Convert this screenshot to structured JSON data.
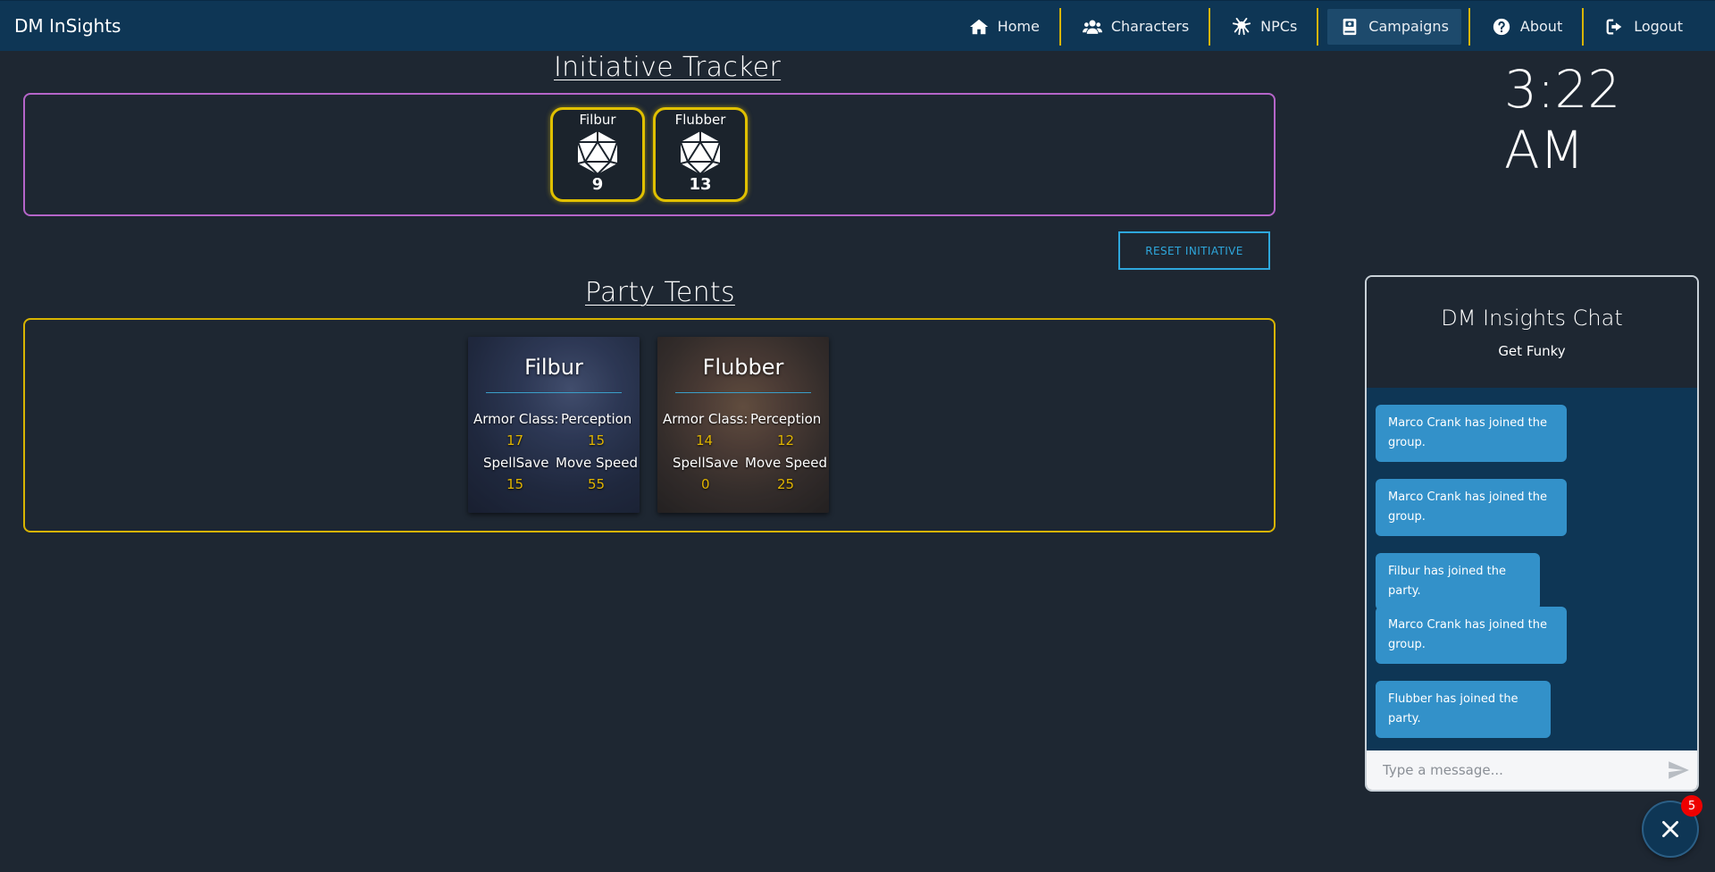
{
  "brand": "DM InSights",
  "nav": {
    "items": [
      {
        "label": "Home",
        "icon": "home-icon"
      },
      {
        "label": "Characters",
        "icon": "users-icon"
      },
      {
        "label": "NPCs",
        "icon": "npc-icon"
      },
      {
        "label": "Campaigns",
        "icon": "book-icon",
        "active": true
      },
      {
        "label": "About",
        "icon": "question-icon"
      },
      {
        "label": "Logout",
        "icon": "logout-icon"
      }
    ]
  },
  "initiative": {
    "title": "Initiative Tracker",
    "entries": [
      {
        "name": "Filbur",
        "value": "9"
      },
      {
        "name": "Flubber",
        "value": "13"
      }
    ],
    "reset_label": "RESET INITIATIVE"
  },
  "tents": {
    "title": "Party Tents",
    "cards": [
      {
        "name": "Filbur",
        "labels": {
          "ac": "Armor Class:",
          "perception": "Perception",
          "spellsave": "SpellSave",
          "speed": "Move Speed"
        },
        "values": {
          "ac": "17",
          "perception": "15",
          "spellsave": "15",
          "speed": "55"
        }
      },
      {
        "name": "Flubber",
        "labels": {
          "ac": "Armor Class:",
          "perception": "Perception",
          "spellsave": "SpellSave",
          "speed": "Move Speed"
        },
        "values": {
          "ac": "14",
          "perception": "12",
          "spellsave": "0",
          "speed": "25"
        }
      }
    ]
  },
  "clock": "3:22 AM",
  "chat": {
    "title": "DM Insights Chat",
    "subtitle": "Get Funky",
    "messages": [
      "Marco Crank has joined the group.",
      "Marco Crank has joined the group.",
      "Filbur has joined the party.",
      "Marco Crank has joined the group.",
      "Flubber has joined the party."
    ],
    "input_placeholder": "Type a message...",
    "badge_count": "5"
  },
  "colors": {
    "navbar": "#0e3655",
    "background": "#1e2732",
    "gold": "#d8b400",
    "purple": "#b565c9",
    "accent_blue": "#2ea7dc",
    "message_bubble": "#3391c9"
  }
}
